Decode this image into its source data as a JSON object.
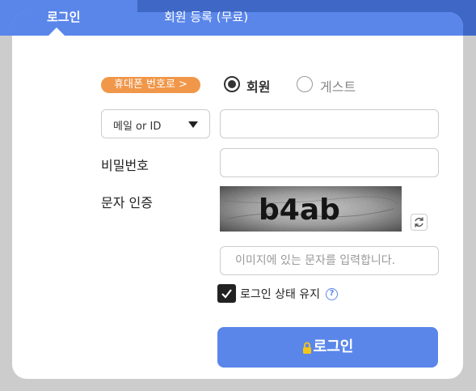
{
  "tabs": {
    "login": "로그인",
    "register": "회원 등록 (무료)"
  },
  "phone_badge": "휴대폰 번호로 >",
  "member_type": {
    "member": "회원",
    "guest": "게스트",
    "selected": "회원"
  },
  "id_select": {
    "selected": "메일 or ID",
    "options": [
      "메일 or ID"
    ]
  },
  "fields": {
    "id_value": "",
    "password_label": "비밀번호",
    "password_value": "",
    "captcha_label": "문자 인증",
    "captcha_text": "b4ab",
    "captcha_placeholder": "이미지에 있는 문자를 입력합니다."
  },
  "keep_login": {
    "label": "로그인 상태 유지",
    "checked": true,
    "help": "?"
  },
  "login_button": "로그인",
  "colors": {
    "accent": "#5a86ea",
    "tabbar": "#3f68c6",
    "badge": "#f0974a"
  },
  "icons": {
    "radio": "radio-icon",
    "dropdown": "triangle-down-icon",
    "refresh": "refresh-icon",
    "check": "check-icon",
    "help": "question-icon",
    "lock": "lock-icon"
  }
}
